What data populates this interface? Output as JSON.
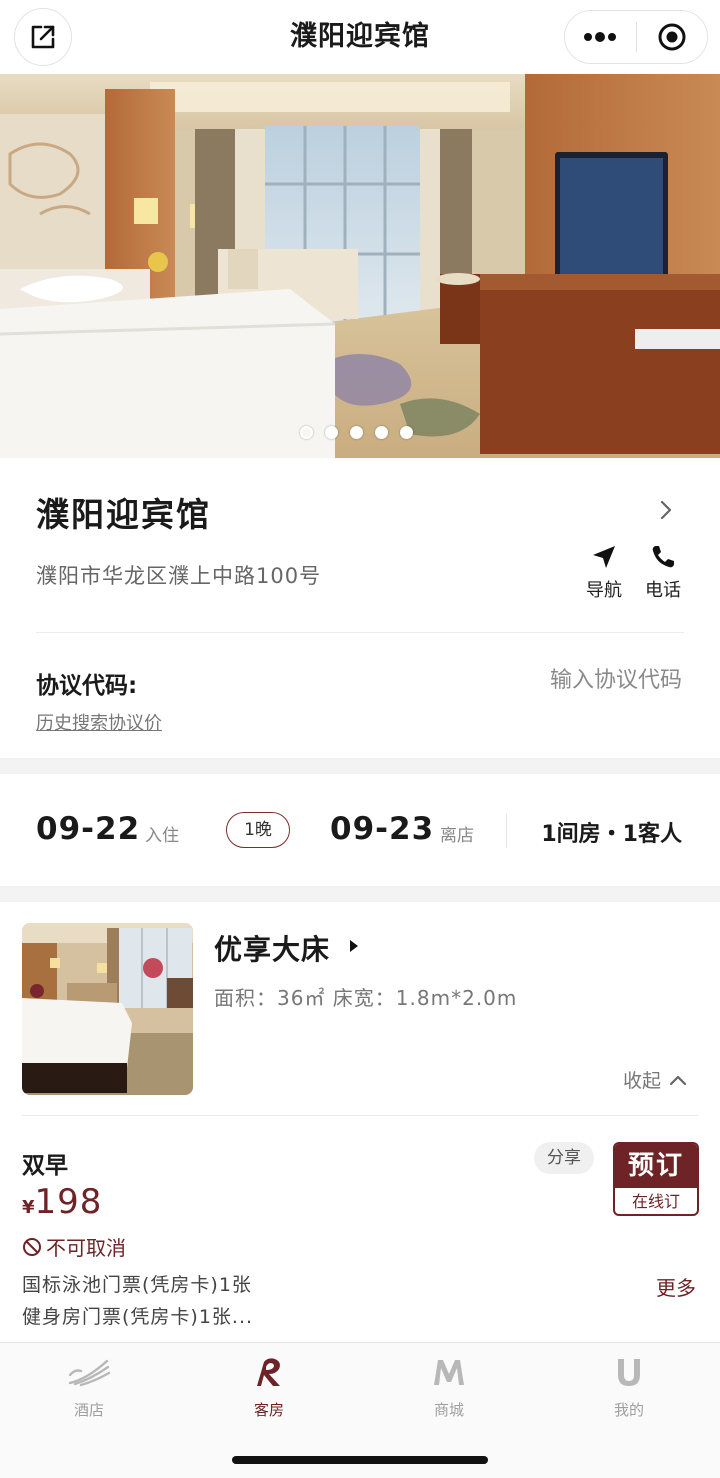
{
  "topbar": {
    "title": "濮阳迎宾馆",
    "share_icon": "external-link-icon",
    "more_icon": "more-dots-icon",
    "close_icon": "target-circle-icon"
  },
  "hero": {
    "slide_count": 5,
    "active_index": 0
  },
  "hotel": {
    "name": "濮阳迎宾馆",
    "address": "濮阳市华龙区濮上中路100号",
    "nav_label": "导航",
    "phone_label": "电话"
  },
  "protocol": {
    "label": "协议代码:",
    "placeholder": "输入协议代码",
    "history_link": "历史搜索协议价"
  },
  "stay": {
    "checkin_date": "09-22",
    "checkin_label": "入住",
    "nights": "1晚",
    "checkout_date": "09-23",
    "checkout_label": "离店",
    "guests": "1间房・1客人"
  },
  "room": {
    "name": "优享大床",
    "spec": "面积：36㎡ 床宽：1.8m*2.0m",
    "collapse_label": "收起",
    "rate": {
      "name": "双早",
      "share_label": "分享",
      "book_label": "预订",
      "book_sub": "在线订",
      "currency": "¥",
      "price": "198",
      "cancel_policy": "不可取消",
      "benefit_1": "国标泳池门票(凭房卡)1张",
      "benefit_2": "健身房门票(凭房卡)1张...",
      "more_label": "更多"
    }
  },
  "tabbar": {
    "tabs": [
      {
        "label": "酒店",
        "icon": "wing-logo-icon",
        "active": false
      },
      {
        "label": "客房",
        "icon": "r-logo-icon",
        "active": true
      },
      {
        "label": "商城",
        "icon": "m-logo-icon",
        "active": false
      },
      {
        "label": "我的",
        "icon": "u-logo-icon",
        "active": false
      }
    ]
  },
  "colors": {
    "brand": "#6e2426",
    "muted": "#888888",
    "background": "#f3f3f3"
  }
}
